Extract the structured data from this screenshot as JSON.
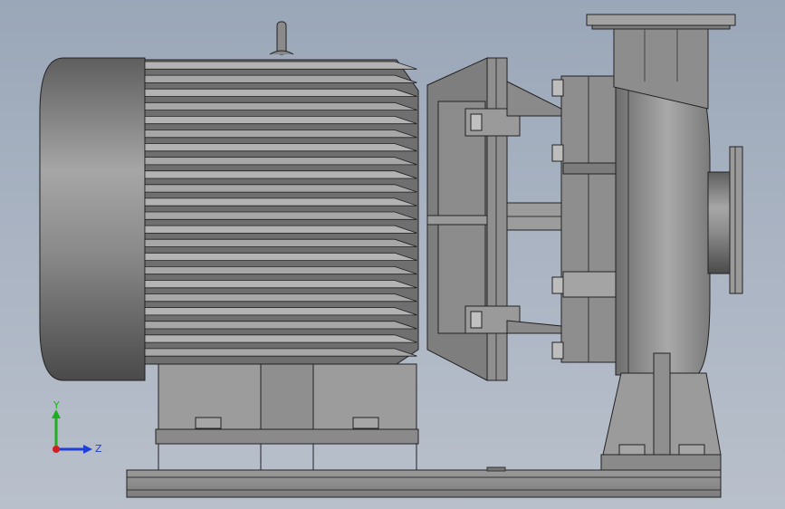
{
  "viewport": {
    "background_top": "#9aa7b8",
    "background_bottom": "#b9c0cb"
  },
  "model": {
    "subject": "centrifugal-pump-with-motor",
    "view": "side-elevation",
    "shading": "shaded-with-edges",
    "body_color": "#8c8c8c",
    "edge_color": "#1e1e1e"
  },
  "triad": {
    "y_label": "Y",
    "z_label": "Z",
    "y_color": "#1fae1f",
    "z_color": "#1f3fd6",
    "x_color": "#d21f1f"
  }
}
